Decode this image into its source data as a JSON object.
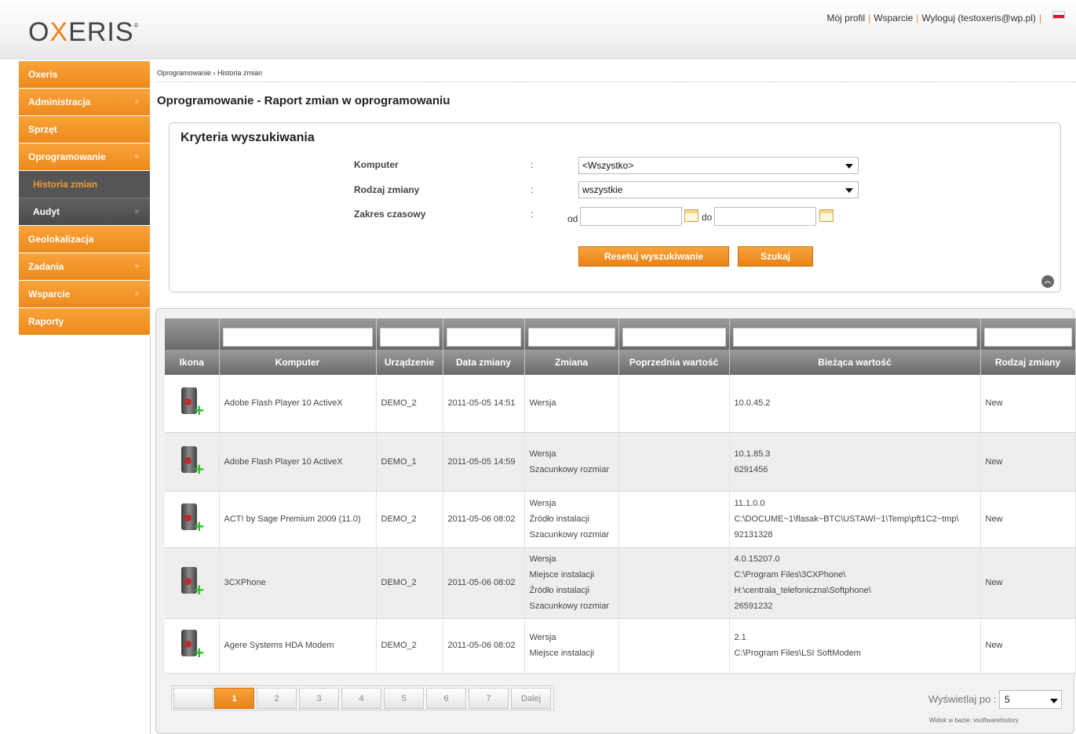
{
  "header": {
    "logo_left": "O",
    "logo_x": "X",
    "logo_right": "ERIS",
    "logo_mark": "®",
    "links": [
      "Mój profil",
      "Wsparcie",
      "Wyloguj (testoxeris@wp.pl)"
    ],
    "separator": "|"
  },
  "sidebar": {
    "items": [
      {
        "label": "Oxeris",
        "chevron": ""
      },
      {
        "label": "Administracja",
        "chevron": "»"
      },
      {
        "label": "Sprzęt",
        "chevron": ""
      },
      {
        "label": "Oprogramowanie",
        "chevron": "»"
      },
      {
        "label": "Historia zmian",
        "chevron": ""
      },
      {
        "label": "Audyt",
        "chevron": "»"
      },
      {
        "label": "Geolokalizacja",
        "chevron": ""
      },
      {
        "label": "Zadania",
        "chevron": "»"
      },
      {
        "label": "Wsparcie",
        "chevron": "»"
      },
      {
        "label": "Raporty",
        "chevron": ""
      }
    ]
  },
  "breadcrumb": "Oprogramowanie › Historia zmian",
  "page_title": "Oprogramowanie - Raport zmian w oprogramowaniu",
  "criteria": {
    "title": "Kryteria wyszukiwania",
    "colon": ":",
    "computer_label": "Komputer",
    "computer_value": "<Wszystko>",
    "change_type_label": "Rodzaj zmiany",
    "change_type_value": "wszystkie",
    "range_label": "Zakres czasowy",
    "from_label": "od",
    "to_label": "do",
    "reset_button": "Resetuj wyszukiwanie",
    "search_button": "Szukaj",
    "collapse_glyph": "︽"
  },
  "table": {
    "columns": [
      "Ikona",
      "Komputer",
      "Urządzenie",
      "Data zmiany",
      "Zmiana",
      "Poprzednia wartość",
      "Bieżąca wartość",
      "Rodzaj zmiany"
    ],
    "rows": [
      {
        "computer": "Adobe Flash Player 10 ActiveX",
        "device": "DEMO_2",
        "date": "2011-05-05 14:51",
        "changes": [
          "Wersja"
        ],
        "previous": [],
        "current": [
          "10.0.45.2"
        ],
        "type": "New"
      },
      {
        "computer": "Adobe Flash Player 10 ActiveX",
        "device": "DEMO_1",
        "date": "2011-05-05 14:59",
        "changes": [
          "Wersja",
          "Szacunkowy rozmiar"
        ],
        "previous": [],
        "current": [
          "10.1.85.3",
          "6291456"
        ],
        "type": "New"
      },
      {
        "computer": "ACT! by Sage Premium 2009 (11.0)",
        "device": "DEMO_2",
        "date": "2011-05-06 08:02",
        "changes": [
          "Wersja",
          "Źródło instalacji",
          "Szacunkowy rozmiar"
        ],
        "previous": [],
        "current": [
          "11.1.0.0",
          "C:\\DOCUME~1\\flasak~BTC\\USTAWI~1\\Temp\\pft1C2~tmp\\",
          "92131328"
        ],
        "type": "New"
      },
      {
        "computer": "3CXPhone",
        "device": "DEMO_2",
        "date": "2011-05-06 08:02",
        "changes": [
          "Wersja",
          "Miejsce instalacji",
          "Źródło instalacji",
          "Szacunkowy rozmiar"
        ],
        "previous": [],
        "current": [
          "4.0.15207.0",
          "C:\\Program Files\\3CXPhone\\",
          "H:\\centrala_telefoniczna\\Softphone\\",
          "26591232"
        ],
        "type": "New"
      },
      {
        "computer": "Agere Systems HDA Modem",
        "device": "DEMO_2",
        "date": "2011-05-06 08:02",
        "changes": [
          "Wersja",
          "Miejsce instalacji"
        ],
        "previous": [],
        "current": [
          "2.1",
          "C:\\Program Files\\LSI SoftModem"
        ],
        "type": "New"
      }
    ]
  },
  "pagination": {
    "pages": [
      "",
      "1",
      "2",
      "3",
      "4",
      "5",
      "6",
      "7",
      "Dalej"
    ],
    "active_page": "1",
    "per_page_label": "Wyświetlaj po :",
    "per_page_value": "5",
    "view_note": "Widok w bazie: vsoftwarehistory"
  },
  "colors": {
    "accent": "#ee8a1c",
    "header_gray": "#7a7a7a",
    "add_icon": "#2bbf2b"
  }
}
